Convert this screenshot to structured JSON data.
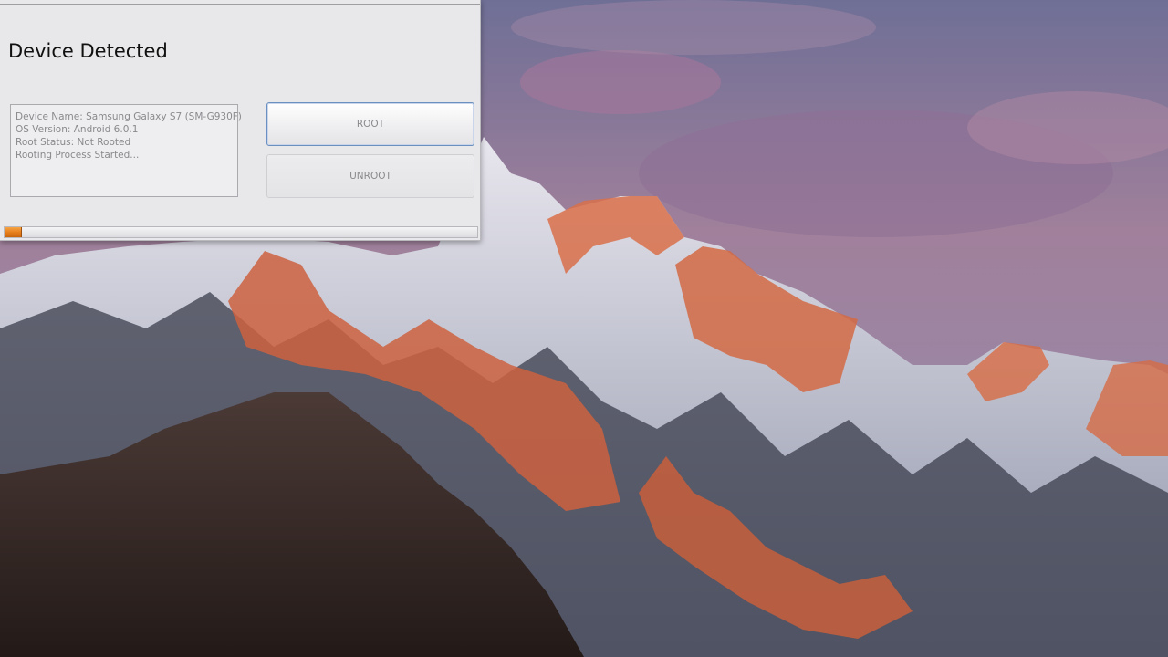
{
  "window": {
    "title": "Device Detected",
    "info_lines": [
      "Device Name: Samsung Galaxy S7 (SM-G930F)",
      "OS Version: Android 6.0.1",
      "Root Status: Not Rooted",
      "Rooting Process Started..."
    ],
    "buttons": {
      "root_label": "ROOT",
      "unroot_label": "UNROOT"
    },
    "progress": {
      "value_fraction": 0.037,
      "color": "#e57b18"
    }
  },
  "desktop": {
    "wallpaper": "mountain-sunset"
  }
}
